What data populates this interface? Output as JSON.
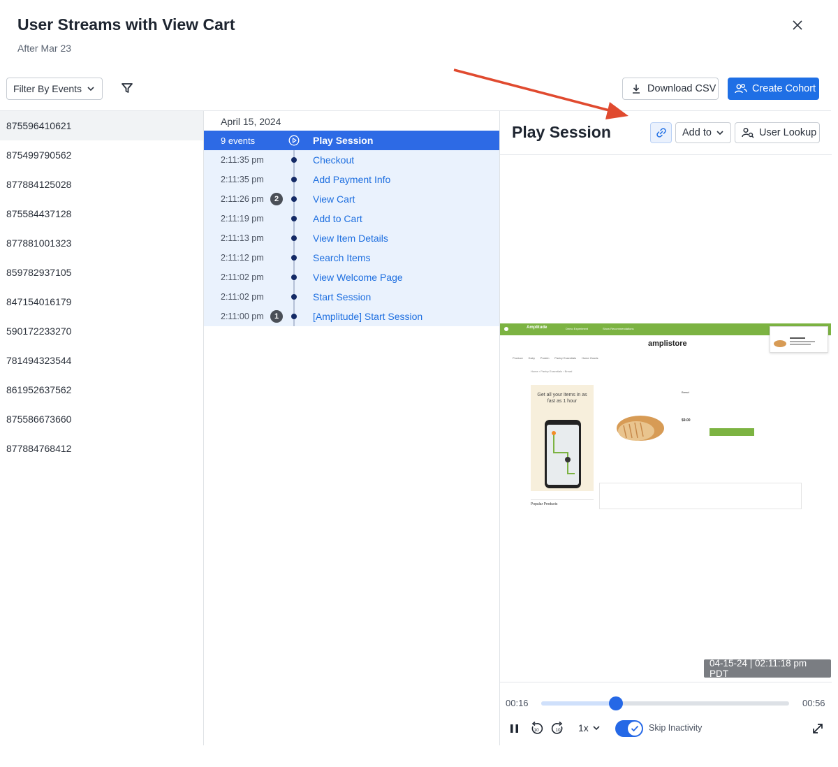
{
  "header": {
    "title": "User Streams with View Cart",
    "subtitle": "After Mar 23"
  },
  "toolbar": {
    "filter_label": "Filter By Events",
    "download_label": "Download CSV",
    "cohort_label": "Create Cohort"
  },
  "users": [
    "875596410621",
    "875499790562",
    "877884125028",
    "875584437128",
    "877881001323",
    "859782937105",
    "847154016179",
    "590172233270",
    "781494323544",
    "861952637562",
    "875586673660",
    "877884768412"
  ],
  "events": {
    "date": "April 15, 2024",
    "summary": {
      "count_label": "9 events",
      "name": "Play Session"
    },
    "rows": [
      {
        "time": "2:11:35 pm",
        "name": "Checkout",
        "badge": ""
      },
      {
        "time": "2:11:35 pm",
        "name": "Add Payment Info",
        "badge": ""
      },
      {
        "time": "2:11:26 pm",
        "name": "View Cart",
        "badge": "2"
      },
      {
        "time": "2:11:19 pm",
        "name": "Add to Cart",
        "badge": ""
      },
      {
        "time": "2:11:13 pm",
        "name": "View Item Details",
        "badge": ""
      },
      {
        "time": "2:11:12 pm",
        "name": "Search Items",
        "badge": ""
      },
      {
        "time": "2:11:02 pm",
        "name": "View Welcome Page",
        "badge": ""
      },
      {
        "time": "2:11:02 pm",
        "name": "Start Session",
        "badge": ""
      },
      {
        "time": "2:11:00 pm",
        "name": "[Amplitude] Start Session",
        "badge": "1"
      }
    ]
  },
  "player": {
    "title": "Play Session",
    "add_to_label": "Add to",
    "lookup_label": "User Lookup",
    "replay": {
      "store_name": "amplistore",
      "banner_text": "Get all your items in as fast as 1 hour"
    },
    "timestamp": "04-15-24 | 02:11:18 pm PDT",
    "current_time": "00:16",
    "duration": "00:56",
    "progress_fraction": 0.3,
    "speed": "1x",
    "skip_label": "Skip Inactivity",
    "skip_on": true
  },
  "colors": {
    "accent": "#1f6fe5",
    "active_row": "#2d6ae5",
    "row_tint": "#eaf2fd",
    "annotation_arrow": "#e04a2f"
  }
}
